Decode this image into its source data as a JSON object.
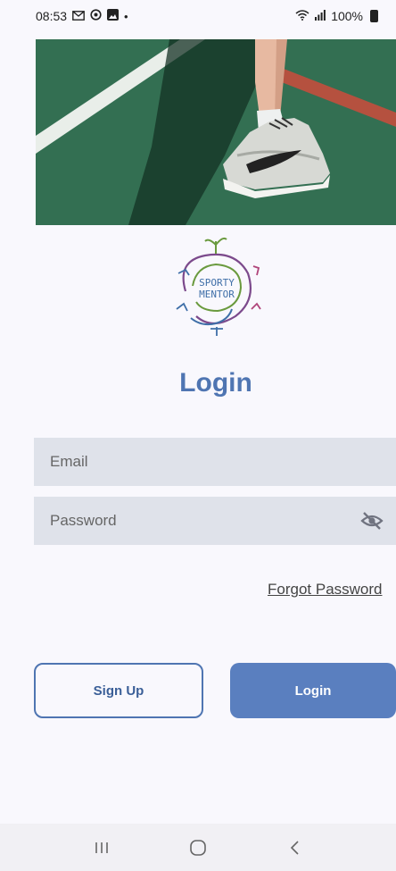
{
  "status_bar": {
    "time": "08:53",
    "left_icons": [
      "mail-icon",
      "sync-icon",
      "image-icon",
      "dot-icon"
    ],
    "battery": "100%"
  },
  "hero": {
    "image": "tennis-shoe-on-court-photo"
  },
  "logo": {
    "line1": "SPORTY",
    "line2": "MENTOR"
  },
  "login": {
    "title": "Login",
    "email_placeholder": "Email",
    "password_placeholder": "Password",
    "forgot_label": "Forgot Password",
    "signup_label": "Sign Up",
    "login_label": "Login"
  },
  "colors": {
    "accent": "#4f75b2",
    "button_fill": "#5a7fbf",
    "field_bg": "#dfe2ea",
    "page_bg": "#f9f8fd"
  }
}
